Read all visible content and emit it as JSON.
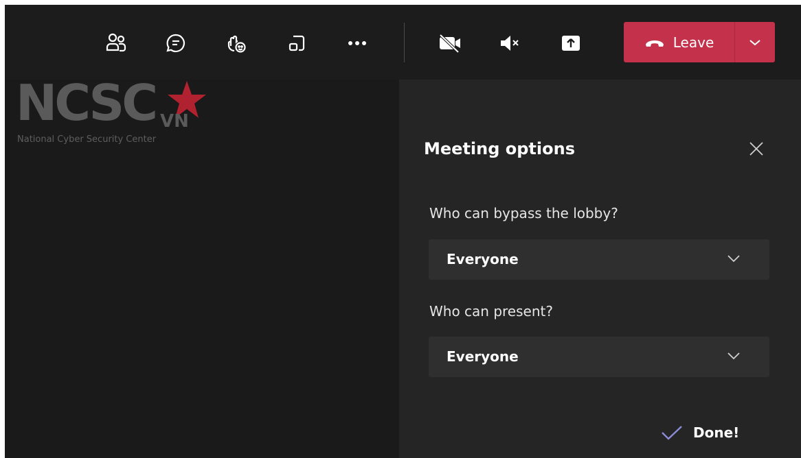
{
  "toolbar": {
    "icons": [
      "participants-icon",
      "chat-icon",
      "reactions-icon",
      "rooms-icon",
      "more-icon",
      "camera-off-icon",
      "mic-muted-icon",
      "share-icon"
    ],
    "leave_label": "Leave",
    "leave_color": "#c4314b"
  },
  "logo": {
    "letters": "NCSC",
    "suffix": "VN",
    "subtitle": "National Cyber Security Center",
    "star_color": "#b0222f"
  },
  "meeting_options": {
    "title": "Meeting options",
    "bypass_lobby": {
      "label": "Who can bypass the lobby?",
      "value": "Everyone"
    },
    "present": {
      "label": "Who can present?",
      "value": "Everyone"
    },
    "done_label": "Done!",
    "accent_color": "#8b8cd8"
  }
}
